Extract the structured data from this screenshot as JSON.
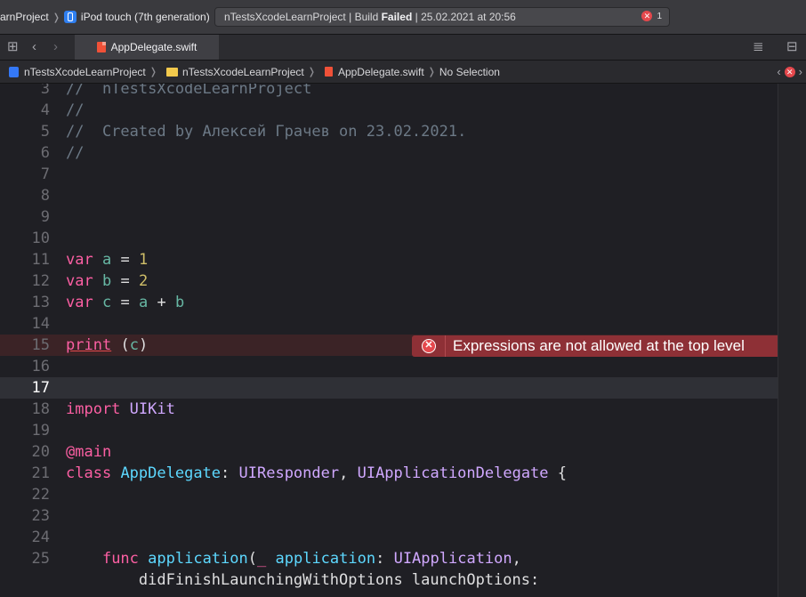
{
  "topbar": {
    "project_breadcrumb": "arnProject",
    "device": "iPod touch (7th generation)",
    "activity": {
      "project": "nTestsXcodeLearnProject",
      "separator1": "|",
      "build_label": "Build",
      "status": "Failed",
      "separator2": "|",
      "timestamp": "25.02.2021 at 20:56"
    },
    "error_count": "1"
  },
  "tabbar": {
    "active_tab": "AppDelegate.swift"
  },
  "jumpbar": {
    "items": [
      "nTestsXcodeLearnProject",
      "nTestsXcodeLearnProject",
      "AppDelegate.swift",
      "No Selection"
    ]
  },
  "editor": {
    "lines": [
      {
        "n": "3",
        "text": "//  nTestsXcodeLearnProject"
      },
      {
        "n": "4",
        "text": "//"
      },
      {
        "n": "5",
        "text": "//  Created by Алексей Грачев on 23.02.2021."
      },
      {
        "n": "6",
        "text": "//"
      },
      {
        "n": "7",
        "text": ""
      },
      {
        "n": "8",
        "text": ""
      },
      {
        "n": "9",
        "text": ""
      },
      {
        "n": "10",
        "text": ""
      },
      {
        "n": "11",
        "text": "var a = 1"
      },
      {
        "n": "12",
        "text": "var b = 2"
      },
      {
        "n": "13",
        "text": "var c = a + b"
      },
      {
        "n": "14",
        "text": ""
      },
      {
        "n": "15",
        "text": "print (c)"
      },
      {
        "n": "16",
        "text": ""
      },
      {
        "n": "17",
        "text": ""
      },
      {
        "n": "18",
        "text": "import UIKit"
      },
      {
        "n": "19",
        "text": ""
      },
      {
        "n": "20",
        "text": "@main"
      },
      {
        "n": "21",
        "text": "class AppDelegate: UIResponder, UIApplicationDelegate {"
      },
      {
        "n": "22",
        "text": ""
      },
      {
        "n": "23",
        "text": ""
      },
      {
        "n": "24",
        "text": ""
      },
      {
        "n": "25",
        "text": "    func application(_ application: UIApplication,"
      },
      {
        "n": "",
        "text": "        didFinishLaunchingWithOptions launchOptions:"
      }
    ],
    "error_message": "Expressions are not allowed at the top level"
  },
  "colors": {
    "background": "#1f1f24",
    "keyword": "#fc5fa3",
    "number": "#d0bf69",
    "comment": "#6c7986",
    "type": "#d0a8ff",
    "error": "#e5484d",
    "error_banner": "#8e3036"
  },
  "icons": [
    "device-icon",
    "grid-icon",
    "back-arrow-icon",
    "forward-arrow-icon",
    "swift-file-icon",
    "editor-options-icon",
    "add-editor-icon",
    "project-icon",
    "folder-icon",
    "error-icon"
  ]
}
